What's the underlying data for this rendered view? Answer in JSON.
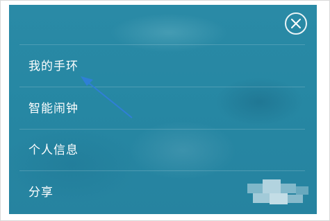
{
  "menu": {
    "items": [
      {
        "label": "我的手环"
      },
      {
        "label": "智能闹钟"
      },
      {
        "label": "个人信息"
      },
      {
        "label": "分享"
      }
    ]
  },
  "icons": {
    "close": "close-icon",
    "annotation": "arrow-icon"
  },
  "colors": {
    "panel_background": "#2687a3",
    "text": "#ffffff",
    "annotation_arrow": "#2f7fd6"
  }
}
